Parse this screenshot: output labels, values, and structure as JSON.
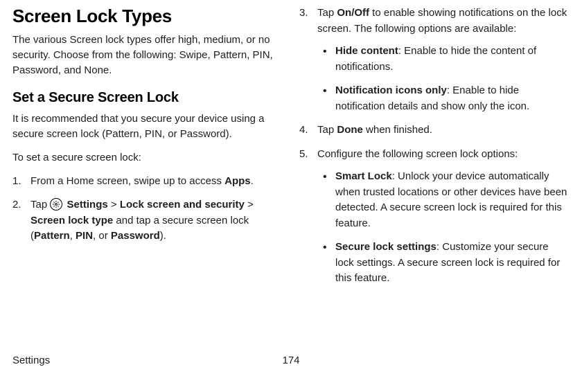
{
  "left": {
    "title": "Screen Lock Types",
    "intro": "The various Screen lock types offer high, medium, or no security. Choose from the following: Swipe, Pattern, PIN, Password, and None.",
    "subheading": "Set a Secure Screen Lock",
    "body1": "It is recommended that you secure your device using a secure screen lock (Pattern, PIN, or Password).",
    "body2": "To set a secure screen lock:",
    "step1_a": "From a Home screen, swipe up to access ",
    "step1_b": "Apps",
    "step1_c": ".",
    "step2_a": "Tap ",
    "step2_b": " Settings",
    "step2_c": " > ",
    "step2_d": "Lock screen and security",
    "step2_e": " > ",
    "step2_f": "Screen lock type",
    "step2_g": " and tap a secure screen lock (",
    "step2_h": "Pattern",
    "step2_i": ", ",
    "step2_j": "PIN",
    "step2_k": ", or ",
    "step2_l": "Password",
    "step2_m": ")."
  },
  "right": {
    "step3_a": "Tap ",
    "step3_b": "On/Off",
    "step3_c": " to enable showing notifications on the lock screen. The following options are available:",
    "b1_a": "Hide content",
    "b1_b": ": Enable to hide the content of notifications.",
    "b2_a": "Notification icons only",
    "b2_b": ": Enable to hide notification details and show only the icon.",
    "step4_a": "Tap ",
    "step4_b": "Done",
    "step4_c": " when finished.",
    "step5_a": "Configure the following screen lock options:",
    "b3_a": "Smart Lock",
    "b3_b": ": Unlock your device automatically when trusted locations or other devices have been detected. A secure screen lock is required for this feature.",
    "b4_a": "Secure lock settings",
    "b4_b": ": Customize your secure lock settings. A secure screen lock is required for this feature."
  },
  "footer": {
    "section": "Settings",
    "page": "174"
  }
}
